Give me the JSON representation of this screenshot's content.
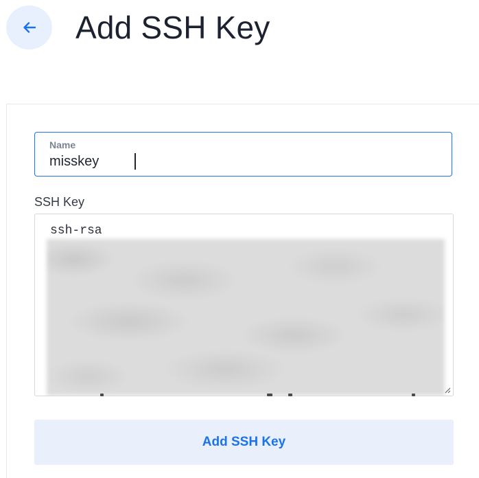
{
  "header": {
    "title": "Add SSH Key",
    "back_icon": "arrow-left-icon"
  },
  "form": {
    "name": {
      "label": "Name",
      "value": "misskey"
    },
    "ssh_key": {
      "label": "SSH Key",
      "value_visible_prefix": "ssh-rsa"
    },
    "submit_label": "Add SSH Key"
  },
  "colors": {
    "accent": "#1a73e8",
    "back_button_bg": "#e8f0fd",
    "submit_bg": "#e9f0fc"
  }
}
